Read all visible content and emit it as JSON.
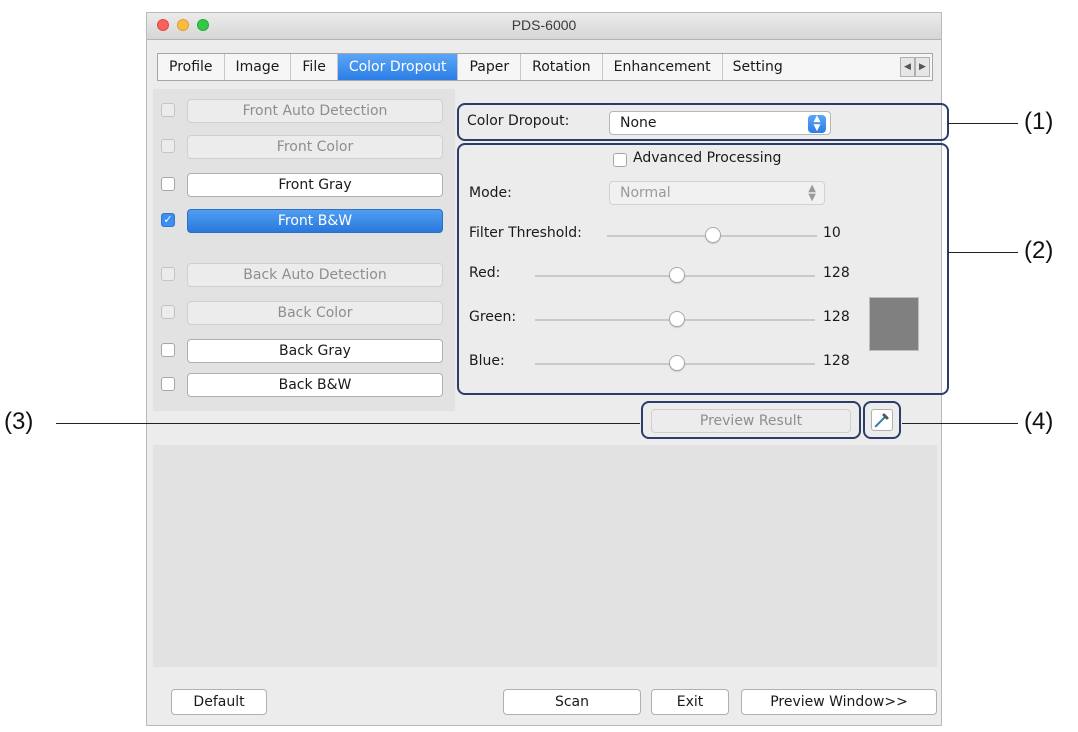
{
  "window": {
    "title": "PDS-6000"
  },
  "tabs": [
    {
      "label": "Profile",
      "active": false
    },
    {
      "label": "Image",
      "active": false
    },
    {
      "label": "File",
      "active": false
    },
    {
      "label": "Color Dropout",
      "active": true
    },
    {
      "label": "Paper",
      "active": false
    },
    {
      "label": "Rotation",
      "active": false
    },
    {
      "label": "Enhancement",
      "active": false
    },
    {
      "label": "Setting",
      "active": false
    }
  ],
  "image_options": [
    {
      "label": "Front Auto Detection",
      "checked": false,
      "enabled": false
    },
    {
      "label": "Front Color",
      "checked": false,
      "enabled": false
    },
    {
      "label": "Front Gray",
      "checked": false,
      "enabled": true
    },
    {
      "label": "Front B&W",
      "checked": true,
      "enabled": true,
      "selected": true
    },
    {
      "label": "Back Auto Detection",
      "checked": false,
      "enabled": false
    },
    {
      "label": "Back Color",
      "checked": false,
      "enabled": false
    },
    {
      "label": "Back Gray",
      "checked": false,
      "enabled": true
    },
    {
      "label": "Back B&W",
      "checked": false,
      "enabled": true
    }
  ],
  "color_dropout": {
    "label": "Color Dropout:",
    "value": "None"
  },
  "advanced": {
    "label": "Advanced Processing",
    "checked": false,
    "mode_label": "Mode:",
    "mode_value": "Normal",
    "filter_label": "Filter Threshold:",
    "filter_value": "10",
    "red_label": "Red:",
    "red_value": "128",
    "green_label": "Green:",
    "green_value": "128",
    "blue_label": "Blue:",
    "blue_value": "128",
    "swatch_color": "#808080"
  },
  "preview_result_label": "Preview Result",
  "buttons": {
    "default": "Default",
    "scan": "Scan",
    "exit": "Exit",
    "preview_window": "Preview Window>>"
  },
  "callouts": {
    "c1": "(1)",
    "c2": "(2)",
    "c3": "(3)",
    "c4": "(4)"
  },
  "colors": {
    "accent": "#2c7ee6",
    "callout_border": "#2d3d6a"
  }
}
